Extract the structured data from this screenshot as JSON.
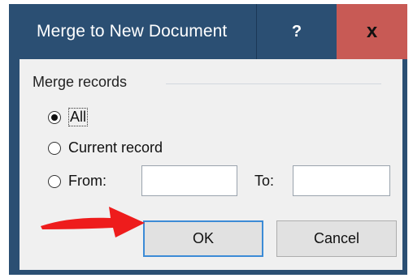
{
  "dialog": {
    "title": "Merge to New Document",
    "help_glyph": "?",
    "close_glyph": "x",
    "titlebar_color": "#2b4f73",
    "close_color": "#c85a55"
  },
  "merge_records": {
    "group_label": "Merge records",
    "options": [
      {
        "label": "All",
        "selected": true
      },
      {
        "label": "Current record",
        "selected": false
      },
      {
        "label": "From:",
        "selected": false
      }
    ],
    "from_value": "",
    "to_label": "To:",
    "to_value": ""
  },
  "buttons": {
    "ok_label": "OK",
    "cancel_label": "Cancel"
  },
  "annotation": {
    "arrow_color": "#ee1c1c",
    "icon": "red-arrow-icon"
  }
}
